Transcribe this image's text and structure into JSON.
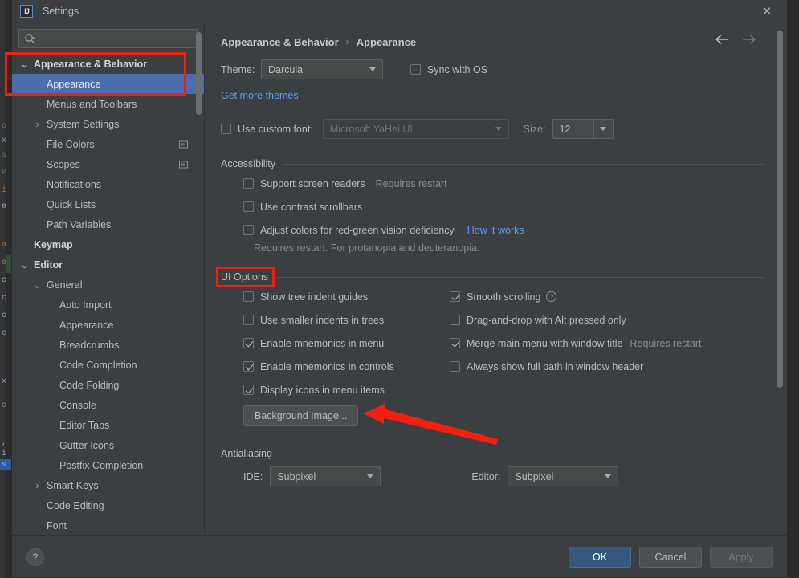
{
  "window": {
    "title": "Settings",
    "logo_text": "IJ",
    "close_icon": "close-icon"
  },
  "search": {
    "value": "",
    "placeholder": "",
    "icon": "search-icon"
  },
  "sidebar": {
    "items": [
      {
        "label": "Appearance & Behavior",
        "indent": 0,
        "twisty": "⌄",
        "bold": true,
        "selected": false,
        "scope_icon": false
      },
      {
        "label": "Appearance",
        "indent": 1,
        "twisty": "",
        "bold": false,
        "selected": true,
        "scope_icon": false
      },
      {
        "label": "Menus and Toolbars",
        "indent": 1,
        "twisty": "",
        "bold": false,
        "selected": false,
        "scope_icon": false
      },
      {
        "label": "System Settings",
        "indent": 1,
        "twisty": "›",
        "bold": false,
        "selected": false,
        "scope_icon": false
      },
      {
        "label": "File Colors",
        "indent": 1,
        "twisty": "",
        "bold": false,
        "selected": false,
        "scope_icon": true
      },
      {
        "label": "Scopes",
        "indent": 1,
        "twisty": "",
        "bold": false,
        "selected": false,
        "scope_icon": true
      },
      {
        "label": "Notifications",
        "indent": 1,
        "twisty": "",
        "bold": false,
        "selected": false,
        "scope_icon": false
      },
      {
        "label": "Quick Lists",
        "indent": 1,
        "twisty": "",
        "bold": false,
        "selected": false,
        "scope_icon": false
      },
      {
        "label": "Path Variables",
        "indent": 1,
        "twisty": "",
        "bold": false,
        "selected": false,
        "scope_icon": false
      },
      {
        "label": "Keymap",
        "indent": 0,
        "twisty": "",
        "bold": true,
        "selected": false,
        "scope_icon": false
      },
      {
        "label": "Editor",
        "indent": 0,
        "twisty": "⌄",
        "bold": true,
        "selected": false,
        "scope_icon": false
      },
      {
        "label": "General",
        "indent": 1,
        "twisty": "⌄",
        "bold": false,
        "selected": false,
        "scope_icon": false
      },
      {
        "label": "Auto Import",
        "indent": 2,
        "twisty": "",
        "bold": false,
        "selected": false,
        "scope_icon": false
      },
      {
        "label": "Appearance",
        "indent": 2,
        "twisty": "",
        "bold": false,
        "selected": false,
        "scope_icon": false
      },
      {
        "label": "Breadcrumbs",
        "indent": 2,
        "twisty": "",
        "bold": false,
        "selected": false,
        "scope_icon": false
      },
      {
        "label": "Code Completion",
        "indent": 2,
        "twisty": "",
        "bold": false,
        "selected": false,
        "scope_icon": false
      },
      {
        "label": "Code Folding",
        "indent": 2,
        "twisty": "",
        "bold": false,
        "selected": false,
        "scope_icon": false
      },
      {
        "label": "Console",
        "indent": 2,
        "twisty": "",
        "bold": false,
        "selected": false,
        "scope_icon": false
      },
      {
        "label": "Editor Tabs",
        "indent": 2,
        "twisty": "",
        "bold": false,
        "selected": false,
        "scope_icon": false
      },
      {
        "label": "Gutter Icons",
        "indent": 2,
        "twisty": "",
        "bold": false,
        "selected": false,
        "scope_icon": false
      },
      {
        "label": "Postfix Completion",
        "indent": 2,
        "twisty": "",
        "bold": false,
        "selected": false,
        "scope_icon": false
      },
      {
        "label": "Smart Keys",
        "indent": 1,
        "twisty": "›",
        "bold": false,
        "selected": false,
        "scope_icon": false
      },
      {
        "label": "Code Editing",
        "indent": 1,
        "twisty": "",
        "bold": false,
        "selected": false,
        "scope_icon": false
      },
      {
        "label": "Font",
        "indent": 1,
        "twisty": "",
        "bold": false,
        "selected": false,
        "scope_icon": false
      }
    ]
  },
  "content": {
    "breadcrumb": {
      "parent": "Appearance & Behavior",
      "separator": "›",
      "current": "Appearance"
    },
    "nav": {
      "back_icon": "arrow-left-icon",
      "forward_icon": "arrow-right-icon"
    },
    "theme": {
      "label": "Theme:",
      "value": "Darcula",
      "sync_with_os_label": "Sync with OS",
      "sync_with_os_checked": false,
      "get_more_themes_link": "Get more themes"
    },
    "font": {
      "use_custom_font_label": "Use custom font:",
      "use_custom_font_checked": false,
      "font_value": "Microsoft YaHei UI",
      "size_label": "Size:",
      "size_value": "12"
    },
    "accessibility": {
      "title": "Accessibility",
      "options": [
        {
          "label": "Support screen readers",
          "checked": false,
          "hint": "Requires restart",
          "link": ""
        },
        {
          "label": "Use contrast scrollbars",
          "checked": false,
          "hint": "",
          "link": ""
        },
        {
          "label": "Adjust colors for red-green vision deficiency",
          "checked": false,
          "hint": "",
          "link": "How it works"
        }
      ],
      "note": "Requires restart. For protanopia and deuteranopia."
    },
    "ui_options": {
      "title": "UI Options",
      "left_column": [
        {
          "label": "Show tree indent guides",
          "checked": false,
          "mnemonic": ""
        },
        {
          "label": "Use smaller indents in trees",
          "checked": false,
          "mnemonic": ""
        },
        {
          "label": "Enable mnemonics in menu",
          "checked": true,
          "mnemonic": "m"
        },
        {
          "label": "Enable mnemonics in controls",
          "checked": true,
          "mnemonic": ""
        },
        {
          "label": "Display icons in menu items",
          "checked": true,
          "mnemonic": ""
        }
      ],
      "right_column": [
        {
          "label": "Smooth scrolling",
          "checked": true,
          "hint": "",
          "help": true
        },
        {
          "label": "Drag-and-drop with Alt pressed only",
          "checked": false,
          "hint": "",
          "help": false
        },
        {
          "label": "Merge main menu with window title",
          "checked": true,
          "hint": "Requires restart",
          "help": false
        },
        {
          "label": "Always show full path in window header",
          "checked": false,
          "hint": "",
          "help": false
        }
      ],
      "background_image_button": "Background Image..."
    },
    "antialiasing": {
      "title": "Antialiasing",
      "ide_label": "IDE:",
      "ide_value": "Subpixel",
      "editor_label": "Editor:",
      "editor_value": "Subpixel"
    }
  },
  "footer": {
    "help_label": "?",
    "ok": "OK",
    "cancel": "Cancel",
    "apply": "Apply"
  },
  "annotations": {
    "highlight_color": "#f01f0f",
    "boxes": [
      "sidebar-appearance-group",
      "ui-options-title"
    ],
    "arrow_points_to": "background-image-button"
  },
  "colors": {
    "accent_blue": "#4b6eaf",
    "link_blue": "#589df6",
    "panel_bg": "#3c3f41",
    "default_button": "#365880",
    "annotation_red": "#f01f0f"
  }
}
